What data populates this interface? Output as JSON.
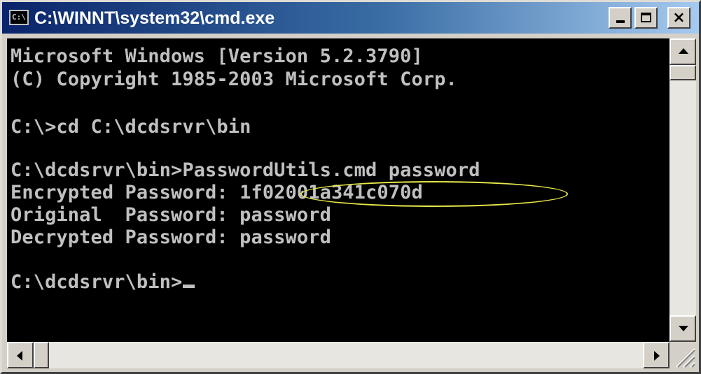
{
  "window": {
    "title": "C:\\WINNT\\system32\\cmd.exe",
    "icon": "cmd-icon",
    "icon_text": "C:\\",
    "controls": {
      "minimize_icon": "minimize-icon",
      "maximize_icon": "maximize-icon",
      "close_icon": "close-icon",
      "close_glyph": "×"
    }
  },
  "console": {
    "lines": [
      "Microsoft Windows [Version 5.2.3790]",
      "(C) Copyright 1985-2003 Microsoft Corp.",
      "",
      "C:\\>cd C:\\dcdsrvr\\bin",
      "",
      "C:\\dcdsrvr\\bin>PasswordUtils.cmd password",
      "Encrypted Password: 1f02001a341c070d",
      "Original  Password: password",
      "Decrypted Password: password",
      "",
      "C:\\dcdsrvr\\bin>"
    ],
    "highlighted_value": "1f02001a341c070d",
    "highlight_color": "#e8e84a",
    "text_color": "#c0c0c0",
    "background_color": "#000000"
  },
  "colors": {
    "titlebar_start": "#0a246a",
    "titlebar_end": "#a6caf0",
    "chrome": "#d4d0c8"
  }
}
